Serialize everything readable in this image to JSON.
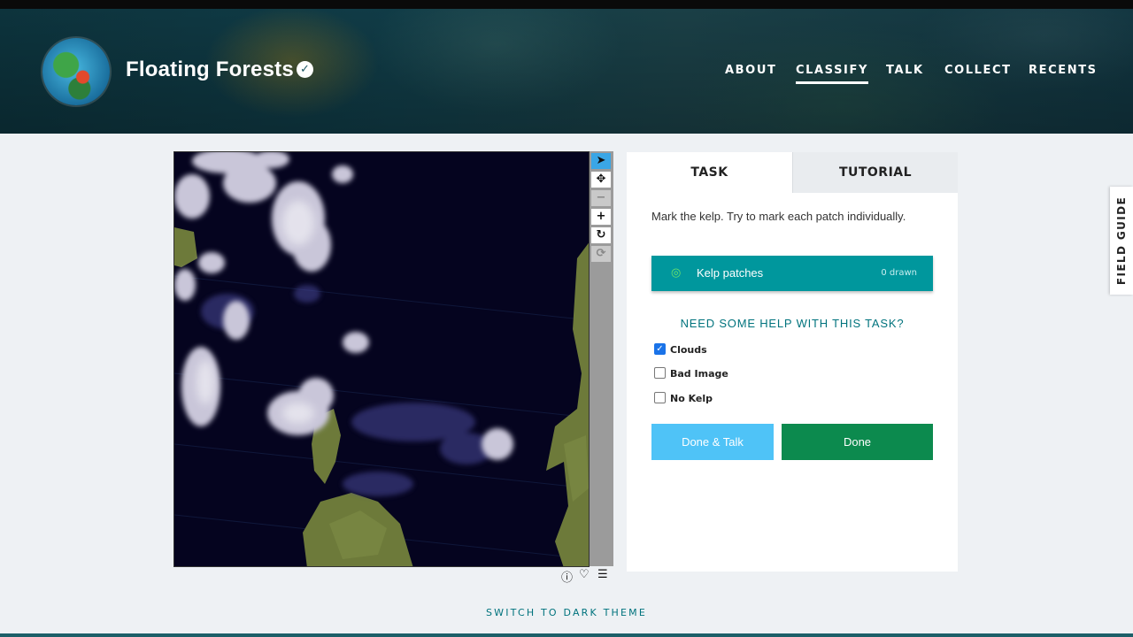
{
  "header": {
    "title": "Floating Forests",
    "nav": [
      "ABOUT",
      "CLASSIFY",
      "TALK",
      "COLLECT",
      "RECENTS"
    ],
    "active_nav": "CLASSIFY"
  },
  "viewer": {
    "toolbar_icons": [
      "pointer-icon",
      "move-icon",
      "zoom-out-icon",
      "zoom-in-icon",
      "rotate-icon",
      "reset-icon"
    ],
    "meta_icons": [
      "info-icon",
      "heart-icon",
      "collections-icon"
    ]
  },
  "panel": {
    "tabs": [
      "TASK",
      "TUTORIAL"
    ],
    "instructions": "Mark the kelp. Try to mark each patch individually.",
    "tool": {
      "label": "Kelp patches",
      "count": "0 drawn"
    },
    "help": "NEED SOME HELP WITH THIS TASK?",
    "checkboxes": [
      {
        "label": "Clouds",
        "checked": true
      },
      {
        "label": "Bad Image",
        "checked": false
      },
      {
        "label": "No Kelp",
        "checked": false
      }
    ],
    "done_talk": "Done & Talk",
    "done": "Done"
  },
  "field_guide": "FIELD GUIDE",
  "theme_link": "SWITCH TO DARK THEME",
  "colors": {
    "teal": "#00979d",
    "done_green": "#0c8a4e",
    "done_talk_blue": "#4fc3f7",
    "link_teal": "#00737d"
  }
}
